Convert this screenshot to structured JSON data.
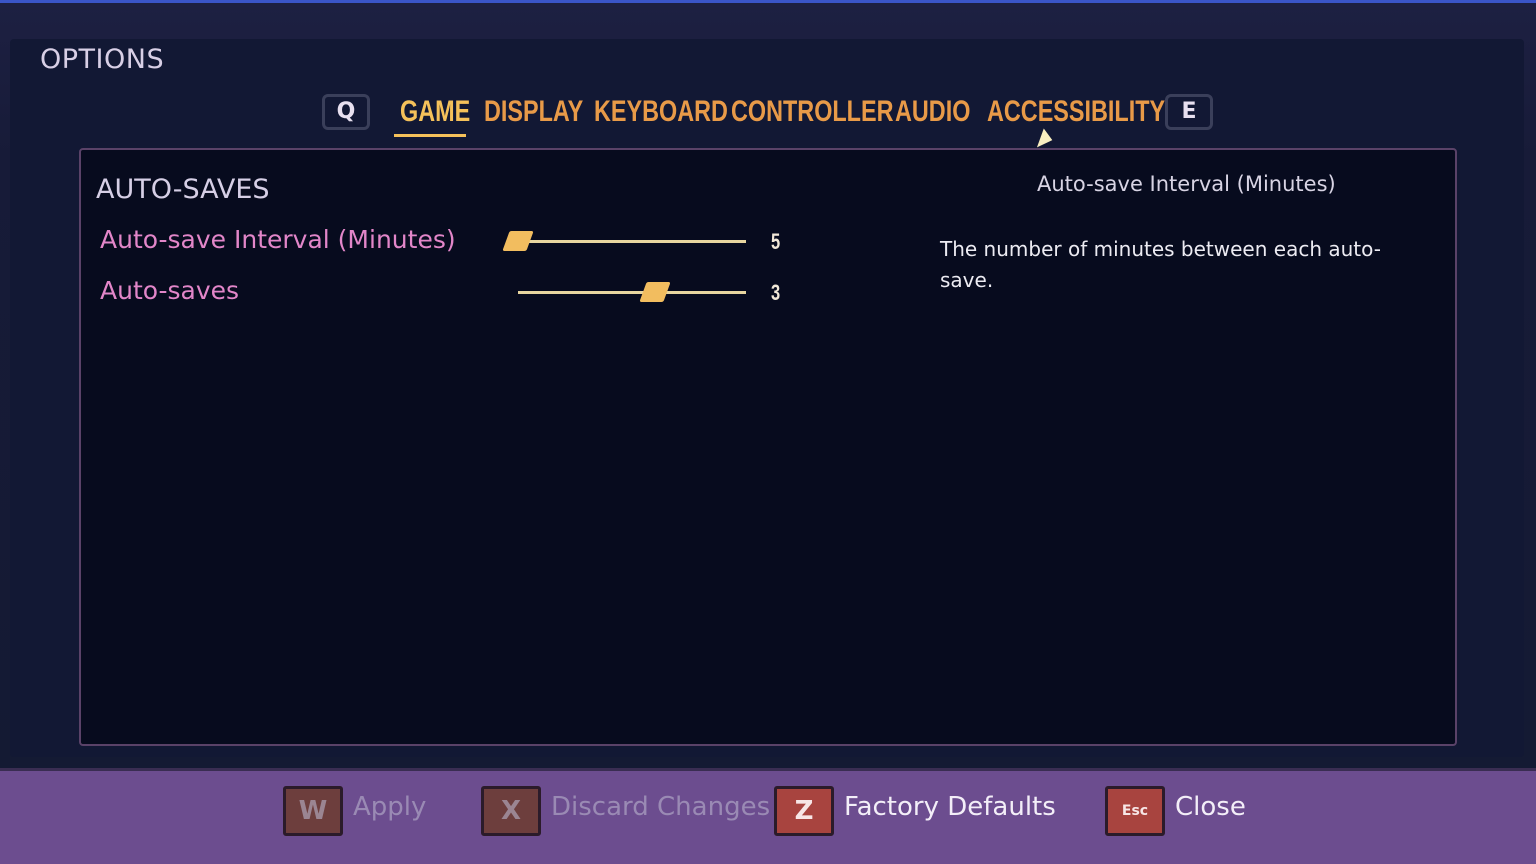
{
  "window": {
    "title": "OPTIONS"
  },
  "tabs": {
    "prev_key": "Q",
    "next_key": "E",
    "items": [
      {
        "label": "GAME",
        "active": true
      },
      {
        "label": "DISPLAY",
        "active": false
      },
      {
        "label": "KEYBOARD",
        "active": false
      },
      {
        "label": "CONTROLLER",
        "active": false
      },
      {
        "label": "AUDIO",
        "active": false
      },
      {
        "label": "ACCESSIBILITY",
        "active": false
      }
    ]
  },
  "section": {
    "title": "AUTO-SAVES",
    "settings": [
      {
        "label": "Auto-save Interval (Minutes)",
        "value": "5",
        "slider_fraction": 0.0
      },
      {
        "label": "Auto-saves",
        "value": "3",
        "slider_fraction": 0.6
      }
    ]
  },
  "help": {
    "title": "Auto-save Interval (Minutes)",
    "description": "The number of minutes between each auto-save."
  },
  "actions": [
    {
      "key": "W",
      "label": "Apply",
      "enabled": false
    },
    {
      "key": "X",
      "label": "Discard Changes",
      "enabled": false
    },
    {
      "key": "Z",
      "label": "Factory Defaults",
      "enabled": true
    },
    {
      "key": "Esc",
      "label": "Close",
      "enabled": true
    }
  ],
  "colors": {
    "accent": "#f5c15a",
    "tab": "#e89a48",
    "setting_label": "#e286c9",
    "bottom_bar": "#6c4d8f",
    "panel_bg": "#070b1e"
  }
}
